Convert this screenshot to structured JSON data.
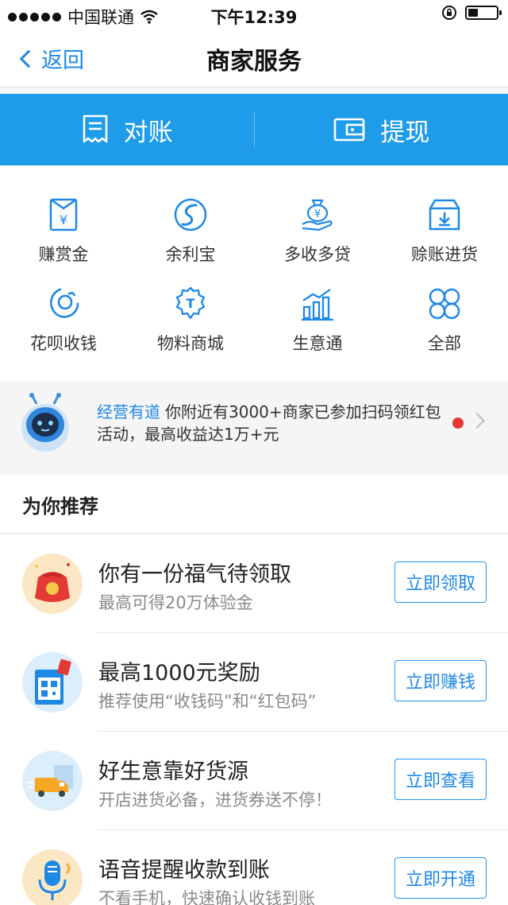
{
  "status_bar": {
    "carrier": "中国联通",
    "time": "下午12:39",
    "battery_level": 0.35
  },
  "nav": {
    "back_label": "返回",
    "title": "商家服务"
  },
  "actions": [
    {
      "label": "对账",
      "icon": "receipt-icon"
    },
    {
      "label": "提现",
      "icon": "wallet-icon"
    }
  ],
  "grid": [
    {
      "label": "赚赏金",
      "icon": "reward-envelope-icon"
    },
    {
      "label": "余利宝",
      "icon": "yulibao-icon"
    },
    {
      "label": "多收多贷",
      "icon": "loan-money-bag-icon"
    },
    {
      "label": "赊账进货",
      "icon": "credit-box-icon"
    },
    {
      "label": "花呗收钱",
      "icon": "huabei-icon"
    },
    {
      "label": "物料商城",
      "icon": "materials-mall-icon"
    },
    {
      "label": "生意通",
      "icon": "business-chart-icon"
    },
    {
      "label": "全部",
      "icon": "all-apps-icon"
    }
  ],
  "notice": {
    "tag": "经营有道",
    "text": "你附近有3000+商家已参加扫码领红包活动，最高收益达1万+元"
  },
  "recommend": {
    "title": "为你推荐",
    "items": [
      {
        "title": "你有一份福气待领取",
        "subtitle": "最高可得20万体验金",
        "button": "立即领取",
        "icon": "red-envelope-icon"
      },
      {
        "title": "最高1000元奖励",
        "subtitle": "推荐使用“收钱码”和“红包码”",
        "button": "立即赚钱",
        "icon": "qr-code-icon"
      },
      {
        "title": "好生意靠好货源",
        "subtitle": "开店进货必备，进货券送不停！",
        "button": "立即查看",
        "icon": "delivery-truck-icon"
      },
      {
        "title": "语音提醒收款到账",
        "subtitle": "不看手机，快速确认收钱到账",
        "button": "立即开通",
        "icon": "microphone-icon"
      }
    ]
  },
  "colors": {
    "accent": "#1e9cea",
    "link": "#1e88e5",
    "alert": "#e53935"
  }
}
